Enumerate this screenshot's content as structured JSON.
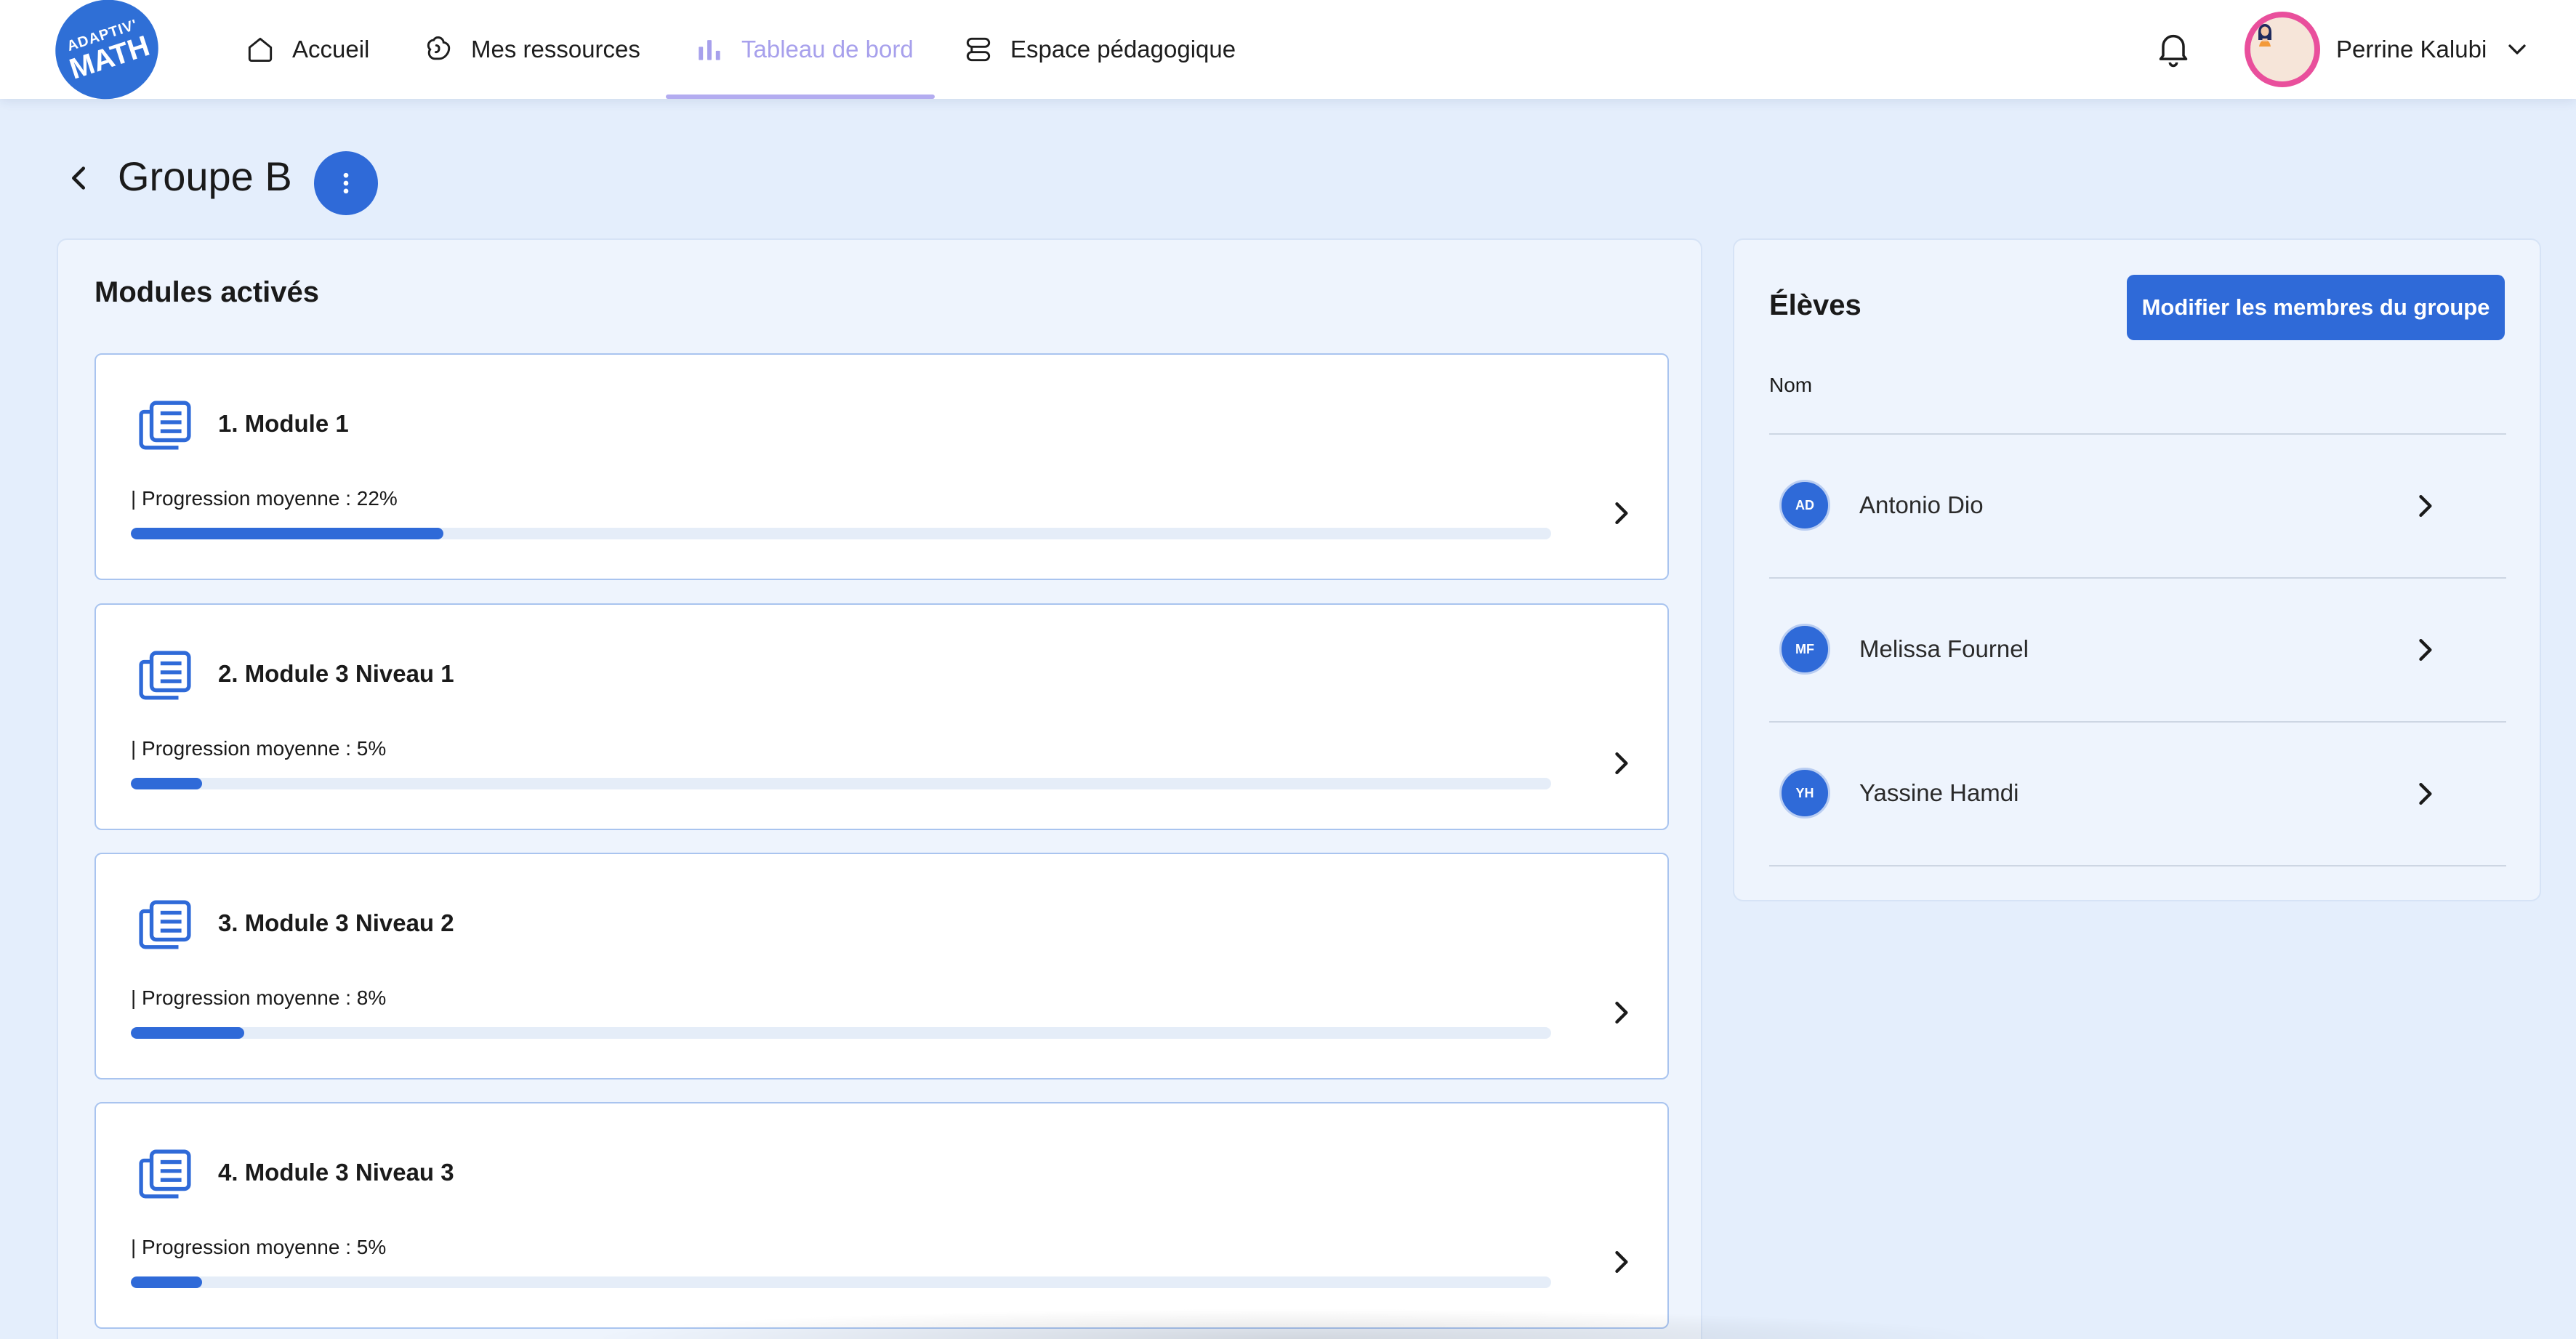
{
  "app": {
    "logo_top": "ADAPTIV'",
    "logo_main": "MATH"
  },
  "nav": {
    "items": [
      {
        "label": "Accueil",
        "icon": "home-icon"
      },
      {
        "label": "Mes ressources",
        "icon": "brain-icon"
      },
      {
        "label": "Tableau de bord",
        "icon": "bar-chart-icon",
        "active": true
      },
      {
        "label": "Espace pédagogique",
        "icon": "stack-icon"
      }
    ]
  },
  "user": {
    "name": "Perrine Kalubi"
  },
  "page": {
    "title": "Groupe B"
  },
  "modules": {
    "title": "Modules activés",
    "items": [
      {
        "name": "1. Module 1",
        "progress_label": "| Progression moyenne : 22%",
        "progress": 22
      },
      {
        "name": "2. Module 3 Niveau 1",
        "progress_label": "| Progression moyenne : 5%",
        "progress": 5
      },
      {
        "name": "3. Module 3 Niveau 2",
        "progress_label": "| Progression moyenne : 8%",
        "progress": 8
      },
      {
        "name": "4. Module 3 Niveau 3",
        "progress_label": "| Progression moyenne : 5%",
        "progress": 5
      }
    ]
  },
  "students": {
    "title": "Élèves",
    "edit_button": "Modifier les membres du groupe",
    "column_name": "Nom",
    "items": [
      {
        "initials": "AD",
        "name": "Antonio Dio"
      },
      {
        "initials": "MF",
        "name": "Melissa Fournel"
      },
      {
        "initials": "YH",
        "name": "Yassine Hamdi"
      }
    ]
  },
  "colors": {
    "primary": "#2f6ad8",
    "active_nav": "#a7a0ec",
    "background": "#e4eefc"
  }
}
